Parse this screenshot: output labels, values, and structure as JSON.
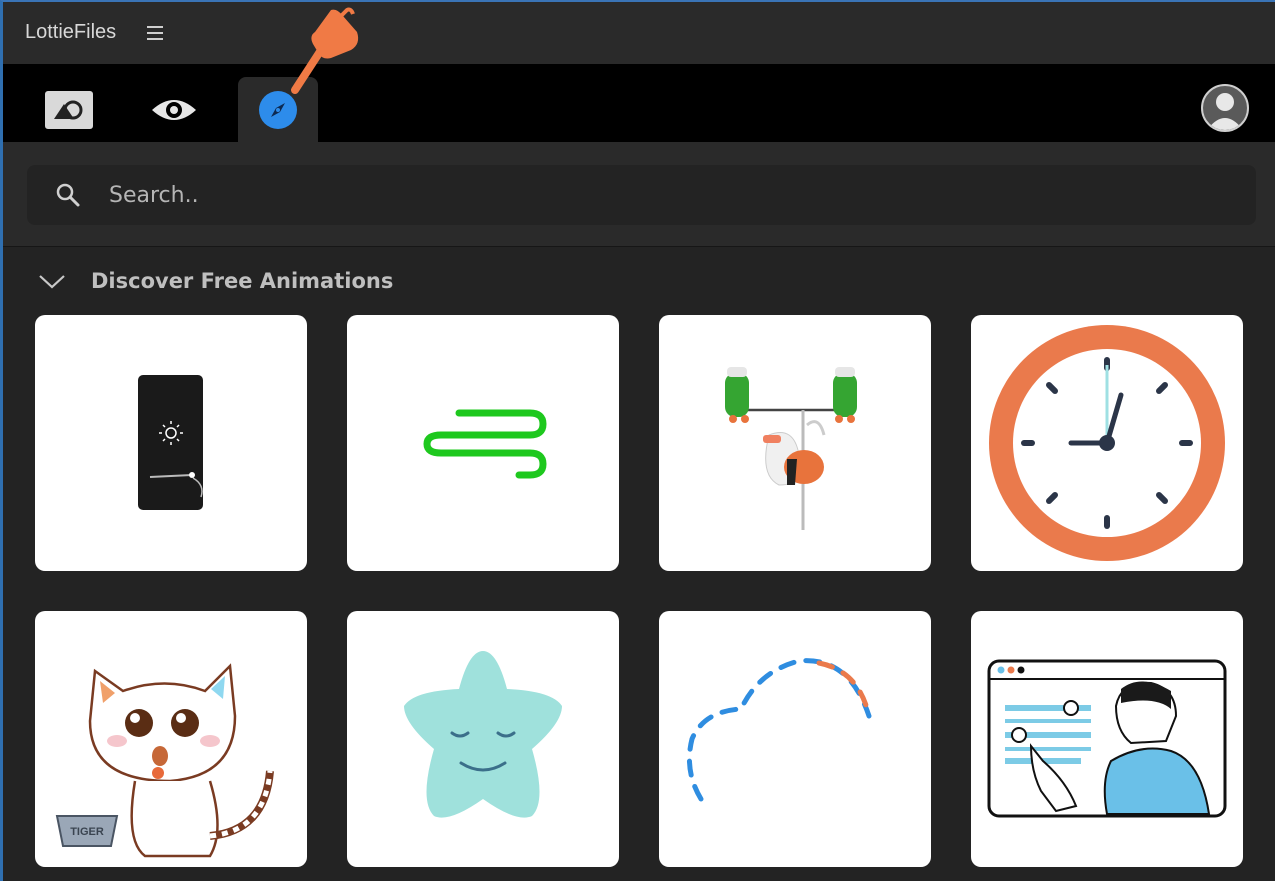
{
  "app": {
    "title": "LottieFiles"
  },
  "search": {
    "placeholder": "Search.."
  },
  "section": {
    "title": "Discover Free Animations"
  },
  "cards": [
    {
      "name": "phone-brightness"
    },
    {
      "name": "green-wind"
    },
    {
      "name": "cactus-weightlifting"
    },
    {
      "name": "orange-clock"
    },
    {
      "name": "crying-cat",
      "bowl_label": "TIGER"
    },
    {
      "name": "sleepy-star"
    },
    {
      "name": "dashed-loader"
    },
    {
      "name": "online-course"
    }
  ],
  "colors": {
    "accent": "#2d8ceb",
    "pointer": "#f07a45",
    "background": "#232323"
  }
}
